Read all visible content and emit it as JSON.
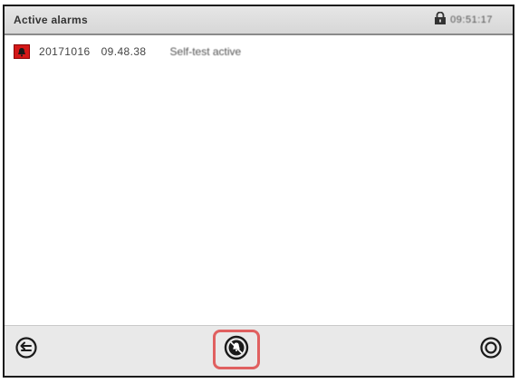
{
  "header": {
    "title": "Active alarms",
    "time": "09:51:17",
    "icon": "lock-icon"
  },
  "alarms": [
    {
      "icon": "alarm-bell-icon",
      "date": "20171016",
      "time": "09.48.38",
      "text": "Self-test active"
    }
  ],
  "footer": {
    "back_icon": "back-arrow-icon",
    "center_icon": "alarm-mute-icon",
    "cancel_icon": "cancel-icon",
    "highlight_color": "#e06060"
  },
  "colors": {
    "alarm_red": "#d41818",
    "header_bg": "#dedede",
    "footer_bg": "#e9e9e9"
  }
}
